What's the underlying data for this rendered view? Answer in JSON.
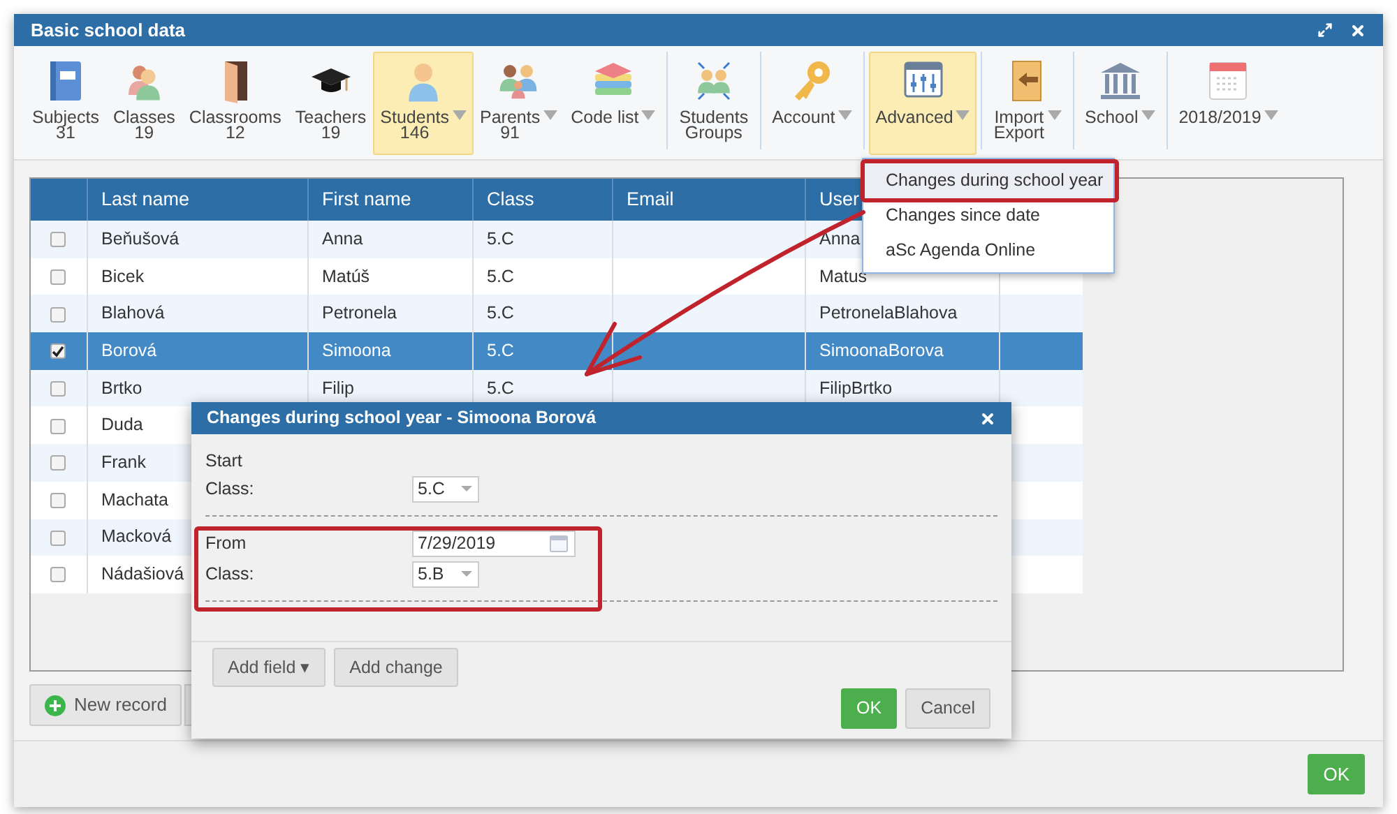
{
  "window": {
    "title": "Basic school data"
  },
  "toolbar": [
    {
      "items": [
        {
          "lines": [
            "Subjects",
            "31"
          ],
          "caret": false,
          "selected": false
        },
        {
          "lines": [
            "Classes",
            "19"
          ],
          "caret": false,
          "selected": false
        },
        {
          "lines": [
            "Classrooms",
            "12"
          ],
          "caret": false,
          "selected": false
        },
        {
          "lines": [
            "Teachers",
            "19"
          ],
          "caret": false,
          "selected": false
        },
        {
          "lines": [
            "Students",
            "146"
          ],
          "caret": true,
          "selected": true
        },
        {
          "lines": [
            "Parents",
            "91"
          ],
          "caret": true,
          "selected": false
        },
        {
          "lines": [
            "Code list"
          ],
          "caret": true,
          "selected": false
        }
      ]
    },
    {
      "items": [
        {
          "lines": [
            "Students",
            "Groups"
          ],
          "caret": false,
          "selected": false
        }
      ]
    },
    {
      "items": [
        {
          "lines": [
            "Account"
          ],
          "caret": true,
          "selected": false
        }
      ]
    },
    {
      "items": [
        {
          "lines": [
            "Advanced"
          ],
          "caret": true,
          "selected": true
        }
      ]
    },
    {
      "items": [
        {
          "lines": [
            "Import",
            "Export"
          ],
          "caret": true,
          "selected": false
        }
      ]
    },
    {
      "items": [
        {
          "lines": [
            "School"
          ],
          "caret": true,
          "selected": false
        }
      ]
    },
    {
      "items": [
        {
          "lines": [
            "2018/2019"
          ],
          "caret": true,
          "selected": false
        }
      ]
    }
  ],
  "table": {
    "columns": [
      "Last name",
      "First name",
      "Class",
      "Email",
      "User"
    ],
    "rows": [
      {
        "checked": false,
        "selected": false,
        "last_name": "Beňušová",
        "first_name": "Anna",
        "class": "5.C",
        "user": "Anna"
      },
      {
        "checked": false,
        "selected": false,
        "last_name": "Bicek",
        "first_name": "Matúš",
        "class": "5.C",
        "user": "Matus"
      },
      {
        "checked": false,
        "selected": false,
        "last_name": "Blahová",
        "first_name": "Petronela",
        "class": "5.C",
        "user": "PetronelaBlahova"
      },
      {
        "checked": true,
        "selected": true,
        "last_name": "Borová",
        "first_name": "Simoona",
        "class": "5.C",
        "user": "SimoonaBorova"
      },
      {
        "checked": false,
        "selected": false,
        "last_name": "Brtko",
        "first_name": "Filip",
        "class": "5.C",
        "user": "FilipBrtko"
      },
      {
        "checked": false,
        "selected": false,
        "last_name": "Duda"
      },
      {
        "checked": false,
        "selected": false,
        "last_name": "Frank"
      },
      {
        "checked": false,
        "selected": false,
        "last_name": "Machata"
      },
      {
        "checked": false,
        "selected": false,
        "last_name": "Macková"
      },
      {
        "checked": false,
        "selected": false,
        "last_name": "Nádašiová"
      }
    ]
  },
  "new_record_button": "New record",
  "menu": {
    "items": [
      {
        "label": "Changes during school year",
        "selected": true
      },
      {
        "label": "Changes since date",
        "selected": false
      },
      {
        "label": "aSc Agenda Online",
        "selected": false
      }
    ]
  },
  "dialog": {
    "title": "Changes during school year - Simoona Borová",
    "start_label": "Start",
    "start_class_label": "Class:",
    "start_class_value": "5.C",
    "from_label": "From",
    "from_date": "7/29/2019",
    "class_label": "Class:",
    "class_value": "5.B",
    "add_field_button": "Add field ▾",
    "add_change_button": "Add change",
    "ok_button": "OK",
    "cancel_button": "Cancel"
  },
  "footer": {
    "ok_button": "OK"
  }
}
